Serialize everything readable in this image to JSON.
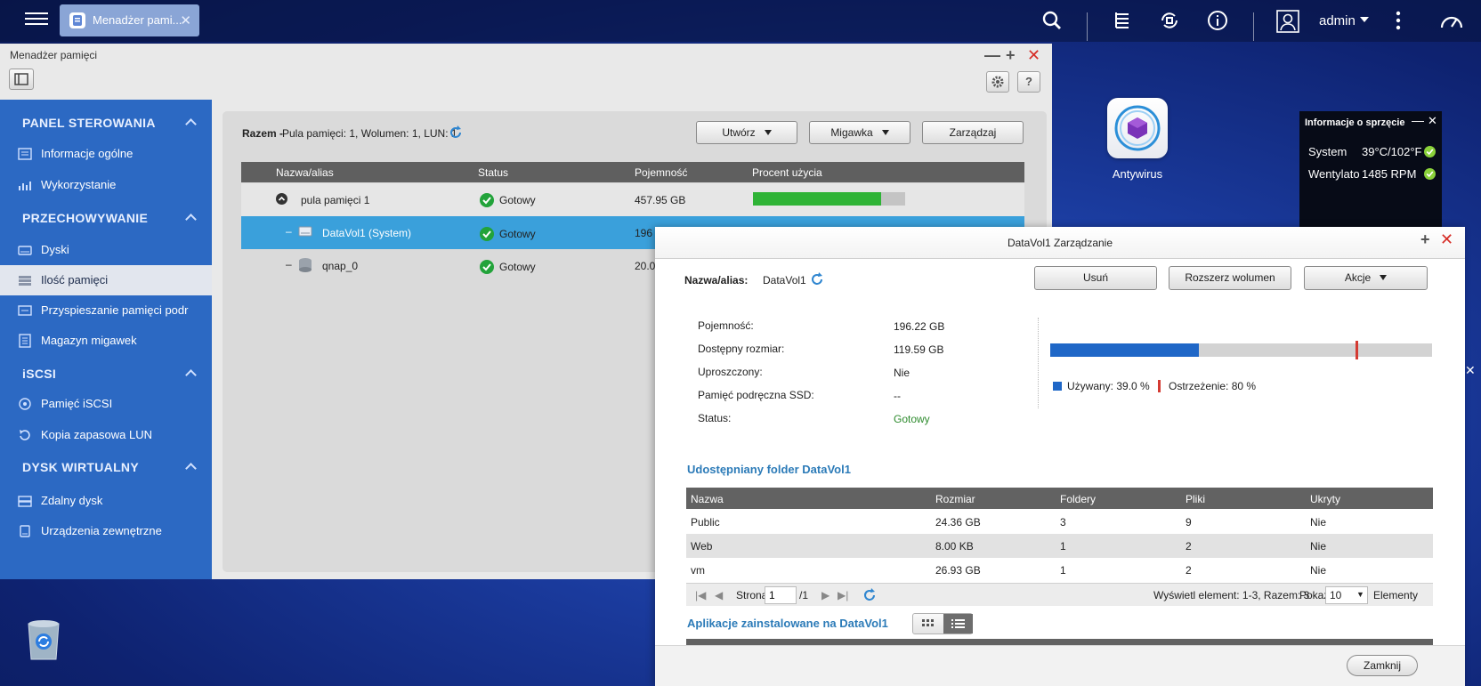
{
  "taskbar": {
    "tab_label": "Menadżer pami...",
    "user": "admin"
  },
  "main_window": {
    "title": "Menadżer pamięci",
    "controls": {
      "minimize": "—",
      "maximize": "+",
      "close": "✕"
    }
  },
  "sidebar": {
    "sections": [
      {
        "title": "PANEL STEROWANIA",
        "items": [
          {
            "label": "Informacje ogólne",
            "icon": "list-icon"
          },
          {
            "label": "Wykorzystanie",
            "icon": "bar-chart-icon"
          }
        ]
      },
      {
        "title": "PRZECHOWYWANIE",
        "items": [
          {
            "label": "Dyski",
            "icon": "disk-icon"
          },
          {
            "label": "Ilość pamięci",
            "icon": "storage-icon",
            "active": true
          },
          {
            "label": "Przyspieszanie pamięci podr",
            "icon": "ssd-cache-icon"
          },
          {
            "label": "Magazyn migawek",
            "icon": "snapshot-icon"
          }
        ]
      },
      {
        "title": "iSCSI",
        "items": [
          {
            "label": "Pamięć iSCSI",
            "icon": "iscsi-icon"
          },
          {
            "label": "Kopia zapasowa LUN",
            "icon": "backup-icon"
          }
        ]
      },
      {
        "title": "DYSK WIRTUALNY",
        "items": [
          {
            "label": "Zdalny dysk",
            "icon": "remote-disk-icon"
          },
          {
            "label": "Urządzenia zewnętrzne",
            "icon": "external-device-icon"
          }
        ]
      }
    ]
  },
  "summary": {
    "label": "Razem -",
    "text": "Pula pamięci: 1, Wolumen: 1, LUN: 1"
  },
  "toolbar": {
    "create": "Utwórz",
    "snapshot": "Migawka",
    "manage": "Zarządzaj"
  },
  "storage_grid": {
    "headers": [
      "Nazwa/alias",
      "Status",
      "Pojemność",
      "Procent użycia"
    ],
    "rows": [
      {
        "name": "pula pamięci 1",
        "status": "Gotowy",
        "capacity": "457.95 GB",
        "usage_fraction": 0.84
      },
      {
        "name": "DataVol1 (System)",
        "status": "Gotowy",
        "capacity": "196"
      },
      {
        "name": "qnap_0",
        "status": "Gotowy",
        "capacity": "20.0"
      }
    ]
  },
  "desktop": {
    "app_label": "Antywirus",
    "hardware": {
      "title": "Informacje o sprzęcie",
      "rows": [
        {
          "label": "System",
          "value": "39°C/102°F"
        },
        {
          "label": "Wentylato",
          "value": "1485 RPM"
        }
      ]
    }
  },
  "dialog": {
    "title": "DataVol1 Zarządzanie",
    "name_label": "Nazwa/alias:",
    "name_value": "DataVol1",
    "buttons": {
      "remove": "Usuń",
      "expand": "Rozszerz wolumen",
      "actions": "Akcje"
    },
    "properties": [
      {
        "label": "Pojemność:",
        "value": "196.22 GB"
      },
      {
        "label": "Dostępny rozmiar:",
        "value": "119.59 GB"
      },
      {
        "label": "Uproszczony:",
        "value": "Nie"
      },
      {
        "label": "Pamięć podręczna SSD:",
        "value": "--"
      },
      {
        "label": "Status:",
        "value": "Gotowy"
      }
    ],
    "usage": {
      "used_fraction": 0.39,
      "warning_fraction": 0.8,
      "used_label": "Używany: 39.0 %",
      "warning_label": "Ostrzeżenie: 80 %",
      "used_color": "#1f67c7",
      "warning_color": "#d43b33"
    },
    "shared_folders": {
      "title": "Udostępniany folder DataVol1",
      "headers": [
        "Nazwa",
        "Rozmiar",
        "Foldery",
        "Pliki",
        "Ukryty"
      ],
      "rows": [
        [
          "Public",
          "24.36 GB",
          "3",
          "9",
          "Nie"
        ],
        [
          "Web",
          "8.00 KB",
          "1",
          "2",
          "Nie"
        ],
        [
          "vm",
          "26.93 GB",
          "1",
          "2",
          "Nie"
        ]
      ]
    },
    "pager": {
      "page_label": "Strona",
      "page_value": "1",
      "page_total": "/1",
      "display_info": "Wyświetl element: 1-3, Razem: 3",
      "show_label": "Pokaż",
      "show_value": "10",
      "items_label": "Elementy"
    },
    "apps_title": "Aplikacje zainstalowane na DataVol1",
    "close": "Zamknij"
  }
}
